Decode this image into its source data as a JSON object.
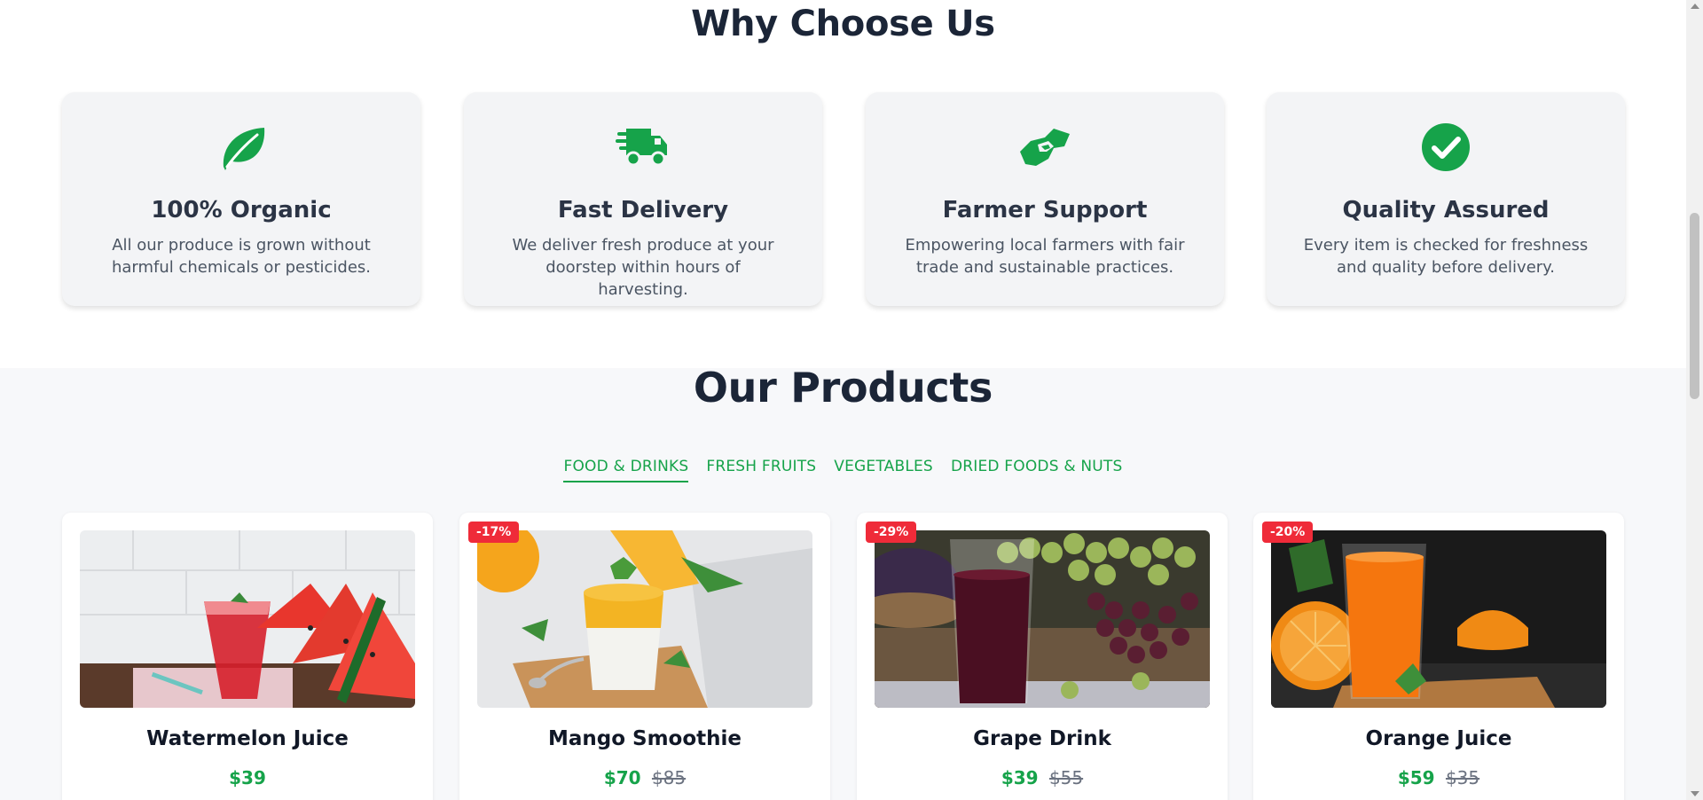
{
  "why_section": {
    "title": "Why Choose Us",
    "features": [
      {
        "icon": "leaf-icon",
        "title": "100% Organic",
        "description": "All our produce is grown without harmful chemicals or pesticides."
      },
      {
        "icon": "truck-fast-icon",
        "title": "Fast Delivery",
        "description": "We deliver fresh produce at your doorstep within hours of harvesting."
      },
      {
        "icon": "handshake-icon",
        "title": "Farmer Support",
        "description": "Empowering local farmers with fair trade and sustainable practices."
      },
      {
        "icon": "check-circle-icon",
        "title": "Quality Assured",
        "description": "Every item is checked for freshness and quality before delivery."
      }
    ]
  },
  "products_section": {
    "title": "Our Products",
    "tabs": [
      {
        "label": "FOOD & DRINKS",
        "active": true
      },
      {
        "label": "FRESH FRUITS",
        "active": false
      },
      {
        "label": "VEGETABLES",
        "active": false
      },
      {
        "label": "DRIED FOODS & NUTS",
        "active": false
      }
    ],
    "products": [
      {
        "name": "Watermelon Juice",
        "price": "$39",
        "old_price": "",
        "discount": ""
      },
      {
        "name": "Mango Smoothie",
        "price": "$70",
        "old_price": "$85",
        "discount": "-17%"
      },
      {
        "name": "Grape Drink",
        "price": "$39",
        "old_price": "$55",
        "discount": "-29%"
      },
      {
        "name": "Orange Juice",
        "price": "$59",
        "old_price": "$35",
        "discount": "-20%"
      }
    ]
  },
  "colors": {
    "accent": "#16a34a",
    "badge": "#ef2b39",
    "card_bg": "#f3f4f6",
    "heading": "#1b2537"
  }
}
